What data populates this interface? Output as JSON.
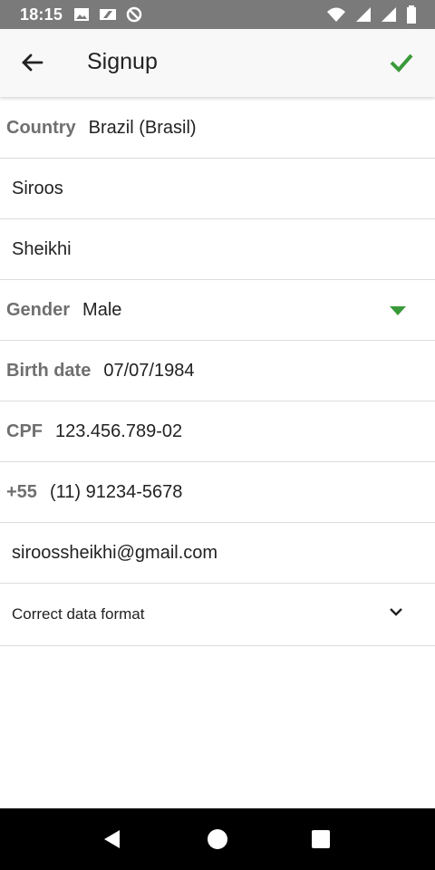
{
  "status": {
    "time": "18:15",
    "icons_left": [
      "image-icon",
      "ticket-icon",
      "no-disturb-icon"
    ],
    "icons_right": [
      "wifi-icon",
      "signal-icon",
      "signal-icon-2",
      "battery-icon"
    ]
  },
  "appbar": {
    "title": "Signup",
    "back_icon": "arrow-left-icon",
    "confirm_icon": "checkmark-icon",
    "confirm_color": "#3a9a3a"
  },
  "form": {
    "country": {
      "label": "Country",
      "value": "Brazil (Brasil)"
    },
    "first_name": {
      "value": "Siroos"
    },
    "last_name": {
      "value": "Sheikhi"
    },
    "gender": {
      "label": "Gender",
      "value": "Male"
    },
    "birth_date": {
      "label": "Birth date",
      "value": "07/07/1984"
    },
    "cpf": {
      "label": "CPF",
      "value": "123.456.789-02"
    },
    "phone": {
      "label": "+55",
      "value": "(11) 91234-5678"
    },
    "email": {
      "value": "siroossheikhi@gmail.com"
    },
    "data_format": {
      "value": "Correct data format"
    }
  },
  "colors": {
    "accent": "#3a9a3a",
    "statusbar": "#7a7a7a",
    "label_gray": "#6f6f6f"
  },
  "navbar": {
    "buttons": [
      "back-triangle-icon",
      "home-circle-icon",
      "recents-square-icon"
    ]
  }
}
